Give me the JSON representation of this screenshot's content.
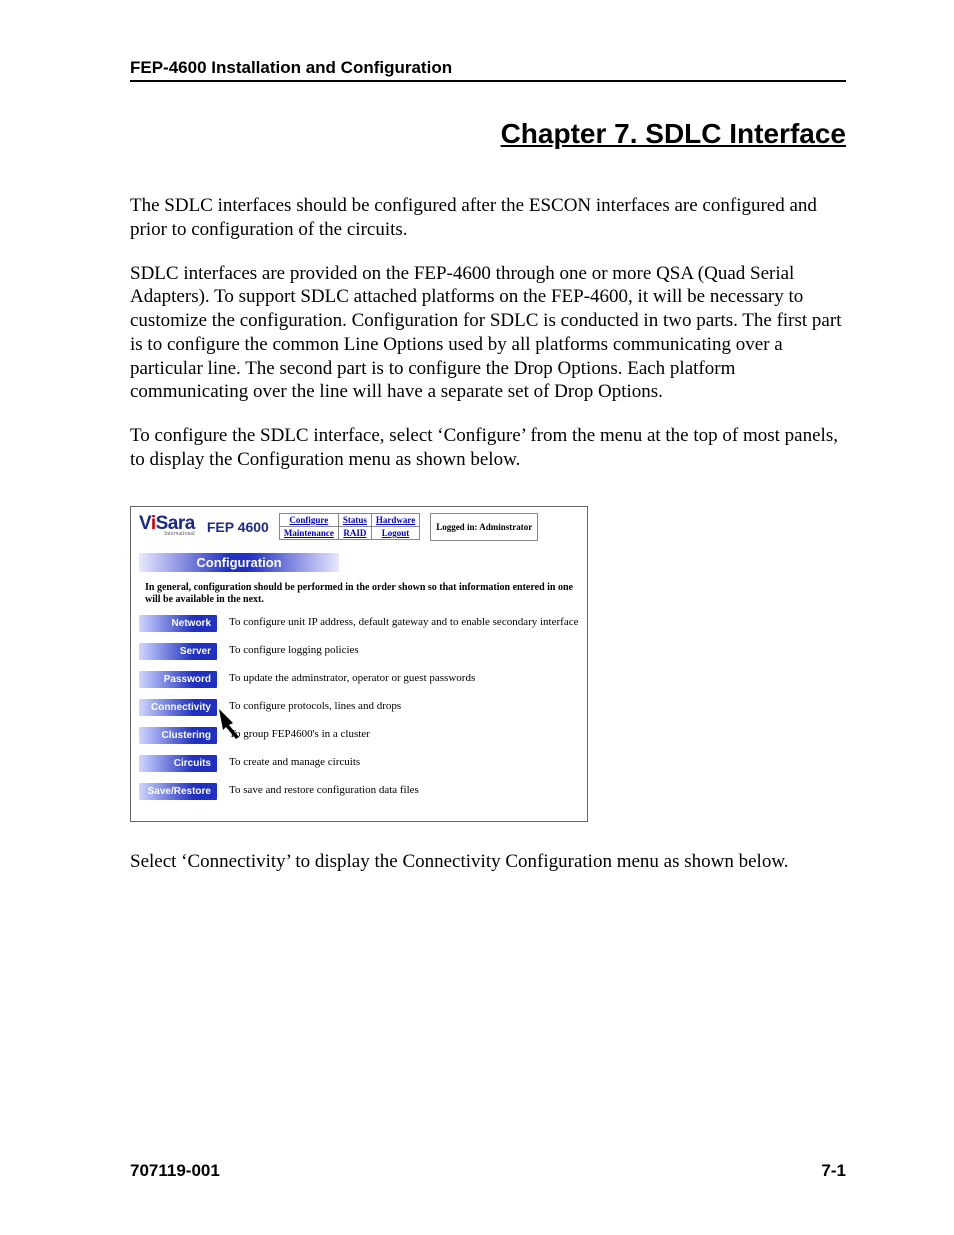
{
  "header": "FEP-4600 Installation and Configuration",
  "chapter_title": "Chapter 7. SDLC Interface",
  "paragraphs": {
    "p1": "The SDLC interfaces should be configured after the ESCON interfaces are configured and prior to configuration of the circuits.",
    "p2": "SDLC interfaces are provided on the FEP-4600 through one or more QSA (Quad Serial Adapters). To support SDLC attached platforms on the FEP-4600, it will be necessary to customize the configuration. Configuration for SDLC is conducted in two parts. The first part is to configure the common Line Options used by all platforms communicating over a particular line. The second part is to configure the Drop Options. Each platform communicating over the line will have a separate set of Drop Options.",
    "p3": "To configure the SDLC interface, select ‘Configure’ from the menu at the top of most panels, to display the Configuration menu as shown below.",
    "p4": "Select ‘Connectivity’ to display the Connectivity Configuration menu as shown below."
  },
  "embedded": {
    "logo": {
      "brand": "V",
      "brand2": "Sara",
      "sub": "International"
    },
    "product": "FEP 4600",
    "nav": {
      "row1": [
        "Configure",
        "Status",
        "Hardware"
      ],
      "row2": [
        "Maintenance",
        "RAID",
        "Logout"
      ]
    },
    "logged_in": "Logged in: Adminstrator",
    "banner": "Configuration",
    "note": "In general, configuration should be performed in the order shown so that information entered in one will be available in the next.",
    "items": [
      {
        "label": "Network",
        "desc": "To configure unit IP address, default gateway and to enable secondary interface"
      },
      {
        "label": "Server",
        "desc": "To configure logging policies"
      },
      {
        "label": "Password",
        "desc": "To update the adminstrator, operator or guest passwords"
      },
      {
        "label": "Connectivity",
        "desc": "To configure protocols, lines and drops"
      },
      {
        "label": "Clustering",
        "desc": "To group FEP4600's in a cluster"
      },
      {
        "label": "Circuits",
        "desc": "To create and manage circuits"
      },
      {
        "label": "Save/Restore",
        "desc": "To save and restore configuration data files"
      }
    ]
  },
  "footer": {
    "left": "707119-001",
    "right": "7-1"
  }
}
